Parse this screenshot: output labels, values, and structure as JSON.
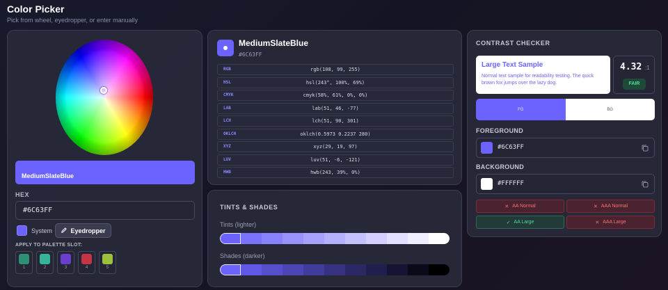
{
  "header": {
    "title": "Color Picker",
    "subtitle": "Pick from wheel, eyedropper, or enter manually"
  },
  "picker": {
    "swatch_name": "MediumSlateBlue",
    "hex_label": "HEX",
    "hex_value": "#6C63FF",
    "system_label": "System",
    "eyedropper_label": "Eyedropper",
    "palette_label": "APPLY TO PALETTE SLOT:",
    "slots": [
      {
        "num": "1",
        "color": "#2d8f74"
      },
      {
        "num": "2",
        "color": "#35b598"
      },
      {
        "num": "3",
        "color": "#6a3fd0"
      },
      {
        "num": "4",
        "color": "#c23446"
      },
      {
        "num": "5",
        "color": "#9bc23a"
      }
    ]
  },
  "values": {
    "name": "MediumSlateBlue",
    "hex": "#6C63FF",
    "rows": [
      {
        "key": "RGB",
        "value": "rgb(108, 99, 255)"
      },
      {
        "key": "HSL",
        "value": "hsl(243°, 100%, 69%)"
      },
      {
        "key": "CMYK",
        "value": "cmyk(58%, 61%, 0%, 0%)"
      },
      {
        "key": "LAB",
        "value": "lab(51, 46, -77)"
      },
      {
        "key": "LCH",
        "value": "lch(51, 90, 301)"
      },
      {
        "key": "OKLCH",
        "value": "oklch(0.5973 0.2237 280)"
      },
      {
        "key": "XYZ",
        "value": "xyz(29, 19, 97)"
      },
      {
        "key": "LUV",
        "value": "luv(51, -6, -121)"
      },
      {
        "key": "HWB",
        "value": "hwb(243, 39%, 0%)"
      }
    ]
  },
  "tints_shades": {
    "title": "TINTS & SHADES",
    "tints_label": "Tints (lighter)",
    "shades_label": "Shades (darker)",
    "tints": [
      "#6c63ff",
      "#7b73ff",
      "#8982ff",
      "#9892ff",
      "#a7a1ff",
      "#b6b1ff",
      "#c4c1ff",
      "#d3d0ff",
      "#e2e0ff",
      "#f0efff",
      "#ffffff"
    ],
    "shades": [
      "#6c63ff",
      "#6159e6",
      "#564fcc",
      "#4c45b3",
      "#413b99",
      "#363280",
      "#2b2866",
      "#201e4c",
      "#161433",
      "#0b0a19",
      "#000000"
    ]
  },
  "contrast": {
    "title": "CONTRAST CHECKER",
    "sample_large": "Large Text Sample",
    "sample_small": "Normal text sample for readability testing. The quick brown fox jumps over the lazy dog.",
    "ratio": "4.32",
    "ratio_unit": ":1",
    "rating": "FAIR",
    "toggle_fg": "FG",
    "toggle_bg": "BG",
    "fg_label": "FOREGROUND",
    "fg_hex": "#6C63FF",
    "fg_color": "#6c63ff",
    "bg_label": "BACKGROUND",
    "bg_hex": "#FFFFFF",
    "bg_color": "#ffffff",
    "checks": [
      {
        "label": "AA Normal",
        "pass": false
      },
      {
        "label": "AAA Normal",
        "pass": false
      },
      {
        "label": "AA Large",
        "pass": true
      },
      {
        "label": "AAA Large",
        "pass": false
      }
    ]
  }
}
